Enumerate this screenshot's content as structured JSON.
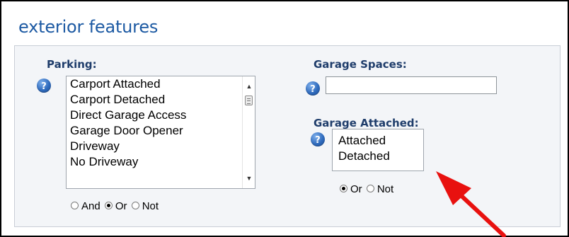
{
  "section": {
    "title": "exterior features"
  },
  "parking": {
    "label": "Parking:",
    "help_icon": "help-question-icon",
    "options": [
      "Carport Attached",
      "Carport Detached",
      "Direct Garage Access",
      "Garage Door Opener",
      "Driveway",
      "No Driveway"
    ],
    "match_modes": [
      "And",
      "Or",
      "Not"
    ],
    "selected_mode": "Or"
  },
  "garage_spaces": {
    "label": "Garage Spaces:",
    "help_icon": "help-question-icon",
    "value": ""
  },
  "garage_attached": {
    "label": "Garage Attached:",
    "help_icon": "help-question-icon",
    "options": [
      "Attached",
      "Detached"
    ],
    "match_modes": [
      "Or",
      "Not"
    ],
    "selected_mode": "Or"
  },
  "annotation": {
    "arrow_color": "#e8110f"
  },
  "colors": {
    "title": "#1d5aa3",
    "label": "#1f3d6b",
    "panel_background": "#f3f5f8"
  }
}
